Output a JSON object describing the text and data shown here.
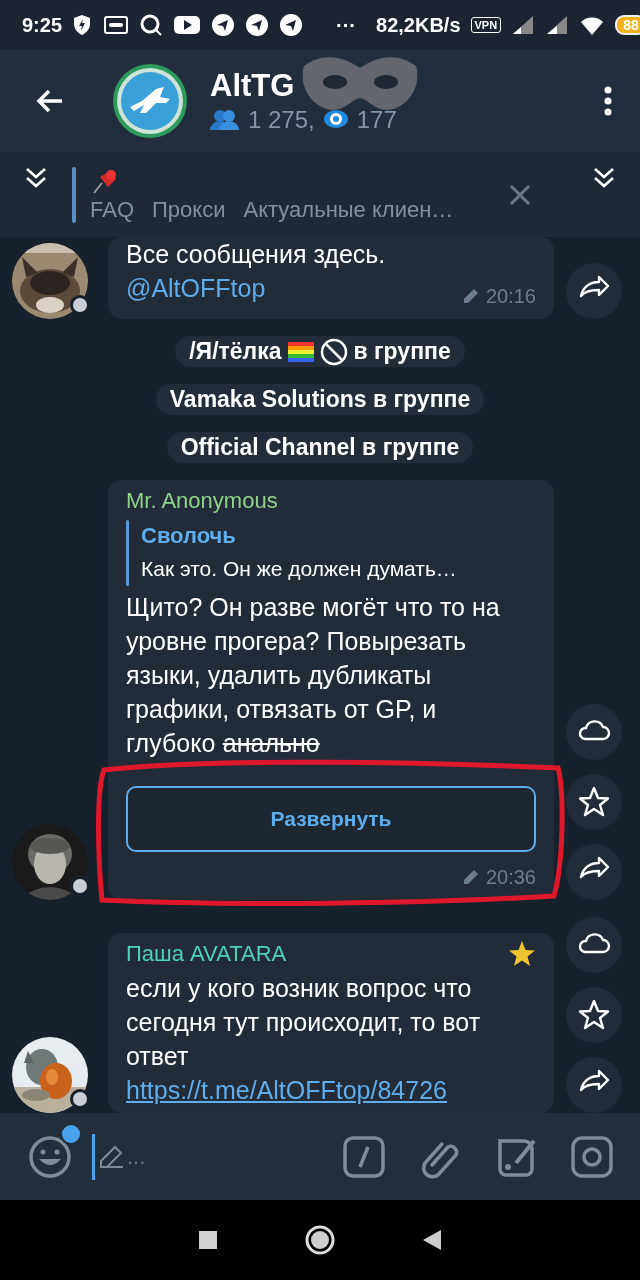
{
  "status_bar": {
    "time": "9:25",
    "more": "···",
    "speed": "82,2KB/s",
    "vpn": "VPN",
    "battery": "88"
  },
  "header": {
    "title": "AltTG",
    "members": "1 275,",
    "online": "177"
  },
  "pinned": {
    "items": [
      "FAQ",
      "Прокси",
      "Актуальные клиен…"
    ]
  },
  "messages": [
    {
      "kind": "message",
      "text": "Все сообщения здесь.",
      "link": "@AltOFFtop",
      "edited": true,
      "time": "20:16",
      "side_buttons": [
        {
          "kind": "share"
        }
      ]
    },
    {
      "kind": "service",
      "text": "/Я/тёлка",
      "emoji": true,
      "suffix": "в группе"
    },
    {
      "kind": "service",
      "text": "Vamaka Solutions в группе"
    },
    {
      "kind": "service",
      "text": "Official Channel в группе"
    },
    {
      "kind": "message",
      "sender": "Mr. Anonymous",
      "color": "#8ed38c",
      "starred": false,
      "reply": {
        "author": "Сволочь",
        "text": "Как это. Он же должен думать…"
      },
      "text": "Щито? Он разве могёт что то на уровне прогера? Повырезать языки, удалить дубликаты графики, отвязать от GP, и глубоко",
      "struck": "анально",
      "expand_button": "Развернуть",
      "edited": true,
      "time": "20:36",
      "annotated": true,
      "side_buttons": [
        {
          "kind": "save"
        },
        {
          "kind": "favorite"
        },
        {
          "kind": "share"
        }
      ]
    },
    {
      "kind": "message",
      "sender": "Паша AVATARA",
      "color": "#4fd2b5",
      "starred": true,
      "text": "если у кого возник вопрос что сегодня тут происходит, то вот ответ",
      "link": "https://t.me/AltOFFtop/84726",
      "side_buttons": [
        {
          "kind": "save"
        },
        {
          "kind": "favorite"
        },
        {
          "kind": "share"
        }
      ]
    }
  ],
  "input": {
    "placeholder": "...",
    "emoji_badge": true
  }
}
